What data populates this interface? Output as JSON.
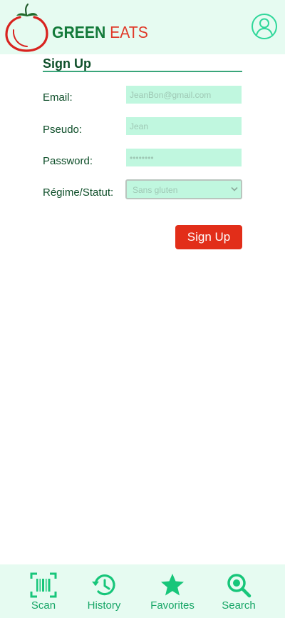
{
  "header": {
    "brand_part1": "GREEN",
    "brand_part2": "EATS",
    "logo_icon": "tomato-logo",
    "profile_icon": "user-circle-icon"
  },
  "form": {
    "title": "Sign Up",
    "email": {
      "label": "Email:",
      "placeholder": "JeanBon@gmail.com",
      "value": ""
    },
    "pseudo": {
      "label": "Pseudo:",
      "placeholder": "Jean",
      "value": ""
    },
    "password": {
      "label": "Password:",
      "placeholder": "••••••••",
      "value": ""
    },
    "regime": {
      "label": "Régime/Statut:",
      "selected": "Sans gluten"
    },
    "submit_label": "Sign Up"
  },
  "nav": {
    "items": [
      {
        "label": "Scan",
        "icon": "barcode-scan-icon"
      },
      {
        "label": "History",
        "icon": "history-icon"
      },
      {
        "label": "Favorites",
        "icon": "star-icon"
      },
      {
        "label": "Search",
        "icon": "search-icon"
      }
    ]
  },
  "colors": {
    "header_bg": "#e6fbf1",
    "input_bg": "#c0f7df",
    "accent_green": "#17a667",
    "dark_green": "#0f4f2a",
    "brand_red": "#e22e19"
  }
}
